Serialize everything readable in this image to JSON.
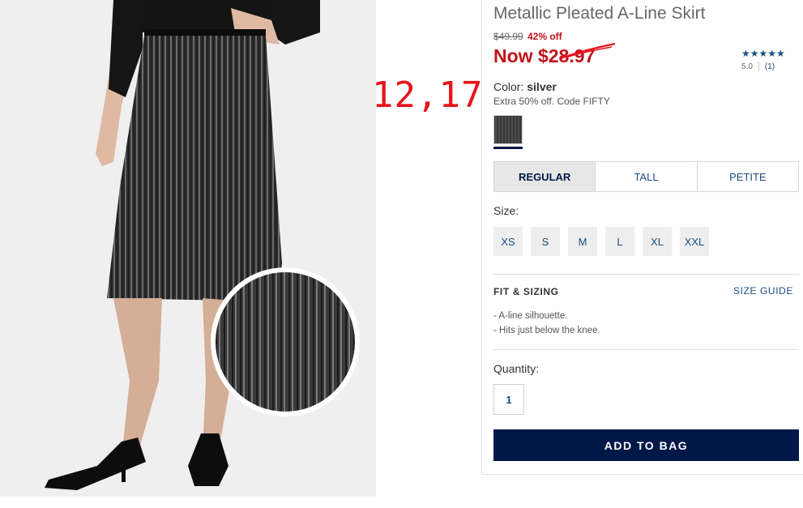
{
  "annotation": {
    "text": "12,17"
  },
  "product": {
    "title": "Metallic Pleated A-Line Skirt",
    "old_price": "$49.99",
    "discount": "42% off",
    "now_price": "Now $28.97",
    "rating": {
      "stars": "★★★★★",
      "score": "5.0",
      "count": "(1)"
    },
    "color": {
      "label": "Color:",
      "value": "silver"
    },
    "promo": "Extra 50% off. Code FIFTY"
  },
  "fit_tabs": [
    {
      "label": "REGULAR",
      "active": true
    },
    {
      "label": "TALL",
      "active": false
    },
    {
      "label": "PETITE",
      "active": false
    }
  ],
  "size": {
    "label": "Size:",
    "options": [
      "XS",
      "S",
      "M",
      "L",
      "XL",
      "XXL"
    ]
  },
  "fit_sizing": {
    "heading": "FIT & SIZING",
    "guide_link": "SIZE GUIDE",
    "bullets": [
      "- A-line silhouette.",
      "- Hits just below the knee."
    ]
  },
  "quantity": {
    "label": "Quantity:",
    "value": "1"
  },
  "add_to_bag": "ADD TO BAG",
  "colors": {
    "navy": "#001848",
    "sale_red": "#c0121b",
    "link_blue": "#1c4d80",
    "annotation_red": "#e8141a"
  }
}
